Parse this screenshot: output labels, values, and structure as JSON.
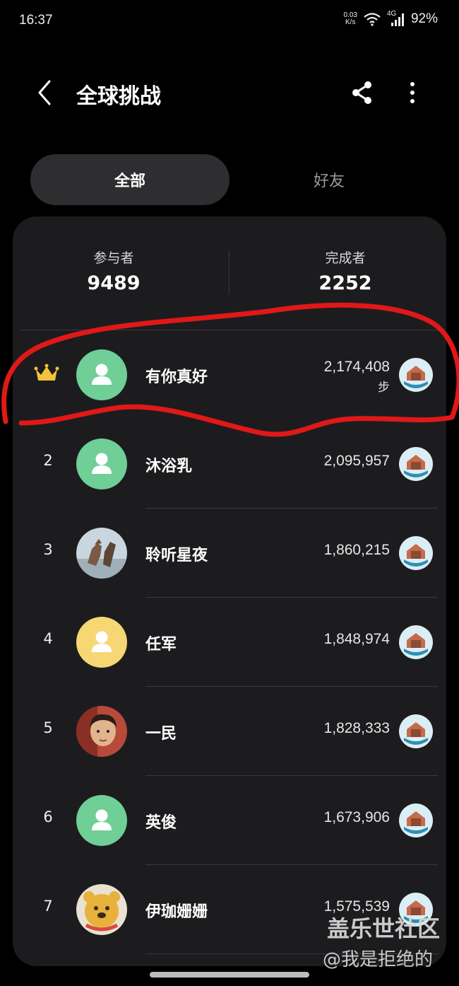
{
  "status_bar": {
    "time": "16:37",
    "net_speed_value": "0.03",
    "net_speed_unit": "K/s",
    "network_type": "4G",
    "battery": "92%"
  },
  "app_bar": {
    "title": "全球挑战",
    "back_icon": "chevron-left-icon",
    "share_icon": "share-icon",
    "more_icon": "more-vertical-icon"
  },
  "tabs": [
    {
      "label": "全部",
      "selected": true
    },
    {
      "label": "好友",
      "selected": false
    }
  ],
  "stats": {
    "participants_label": "参与者",
    "participants_value": "9489",
    "finishers_label": "完成者",
    "finishers_value": "2252"
  },
  "leaderboard": [
    {
      "rank": "1",
      "rank_icon": "crown-icon",
      "name": "有你真好",
      "steps": "2,174,408",
      "unit": "步",
      "avatar": "default-green"
    },
    {
      "rank": "2",
      "name": "沐浴乳",
      "steps": "2,095,957",
      "avatar": "default-green"
    },
    {
      "rank": "3",
      "name": "聆听星夜",
      "steps": "1,860,215",
      "avatar": "photo-horses"
    },
    {
      "rank": "4",
      "name": "任军",
      "steps": "1,848,974",
      "avatar": "default-yellow"
    },
    {
      "rank": "5",
      "name": "一民",
      "steps": "1,828,333",
      "avatar": "photo-child"
    },
    {
      "rank": "6",
      "name": "英俊",
      "steps": "1,673,906",
      "avatar": "default-green"
    },
    {
      "rank": "7",
      "name": "伊珈姗姗",
      "steps": "1,575,539",
      "avatar": "photo-bear"
    }
  ],
  "colors": {
    "background": "#000000",
    "card": "#1c1c1f",
    "tab_selected": "#2e2e31",
    "avatar_green": "#6fcf97",
    "avatar_yellow": "#f7d774",
    "crown": "#f4c23c",
    "annotation_red": "#e01818"
  },
  "watermark": {
    "title": "盖乐世社区",
    "user": "@我是拒绝的"
  }
}
